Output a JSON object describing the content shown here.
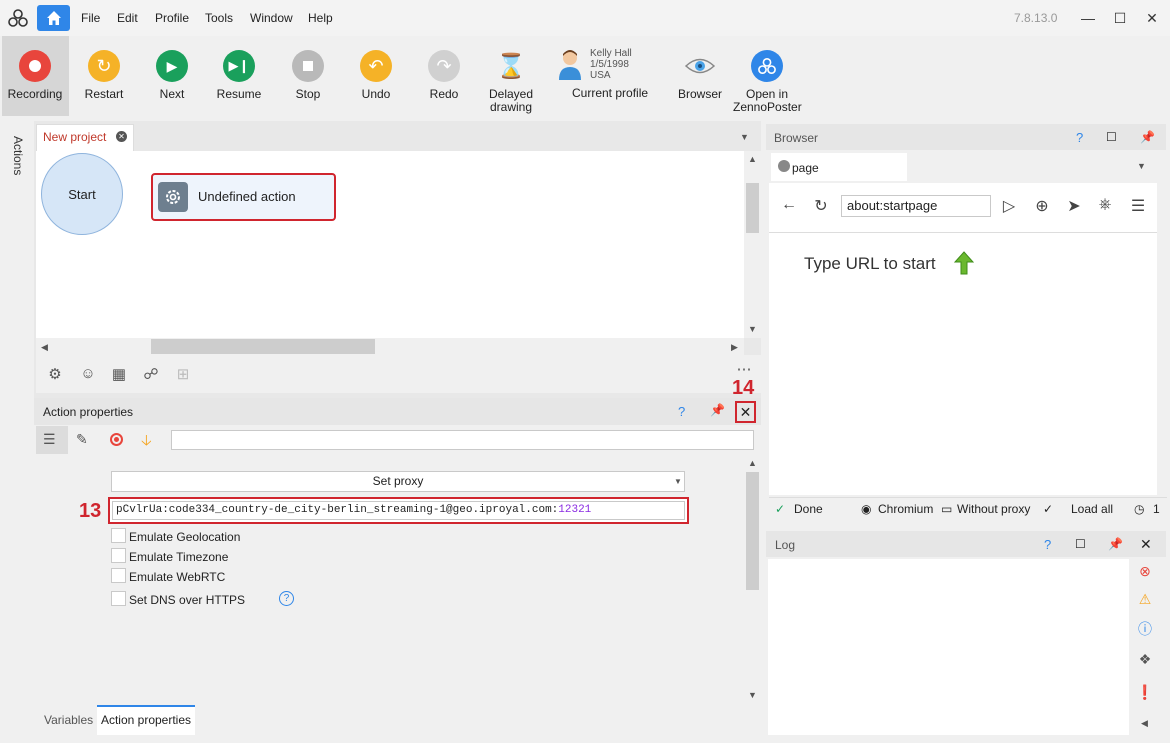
{
  "app": {
    "version": "7.8.13.0"
  },
  "menu": [
    "File",
    "Edit",
    "Profile",
    "Tools",
    "Window",
    "Help"
  ],
  "toolbar": {
    "recording": "Recording",
    "restart": "Restart",
    "next": "Next",
    "resume": "Resume",
    "stop": "Stop",
    "undo": "Undo",
    "redo": "Redo",
    "delayed1": "Delayed",
    "delayed2": "drawing",
    "current_profile": "Current profile",
    "browser": "Browser",
    "open1": "Open in",
    "open2": "ZennoPoster"
  },
  "profile": {
    "name": "Kelly Hall",
    "dob": "1/5/1998",
    "country": "USA"
  },
  "sidebar": {
    "actions": "Actions"
  },
  "project": {
    "tab": "New project",
    "start": "Start",
    "action": "Undefined action"
  },
  "action_properties": {
    "title": "Action properties",
    "help": "?",
    "select_value": "Set proxy",
    "proxy_text": "pCvlrUa:code334_country-de_city-berlin_streaming-1@geo.iproyal.com:",
    "proxy_port": "12321",
    "label13": "13",
    "label14": "14",
    "emulate_geo": "Emulate Geolocation",
    "emulate_tz": "Emulate Timezone",
    "emulate_webrtc": "Emulate WebRTC",
    "dns": "Set DNS over HTTPS"
  },
  "bottom_tabs": {
    "variables": "Variables",
    "action_properties": "Action properties"
  },
  "browser": {
    "title": "Browser",
    "help": "?",
    "tab": "page",
    "url": "about:startpage",
    "hint": "Type URL to start",
    "status": {
      "done": "Done",
      "engine": "Chromium",
      "proxy": "Without proxy",
      "load": "Load all",
      "timer": "1"
    }
  },
  "log": {
    "title": "Log",
    "help": "?"
  },
  "colors": {
    "accent": "#2f86e8",
    "highlight": "#d0252e",
    "recording": "#e8453c",
    "green": "#1aa05c",
    "orange": "#f5a623"
  }
}
